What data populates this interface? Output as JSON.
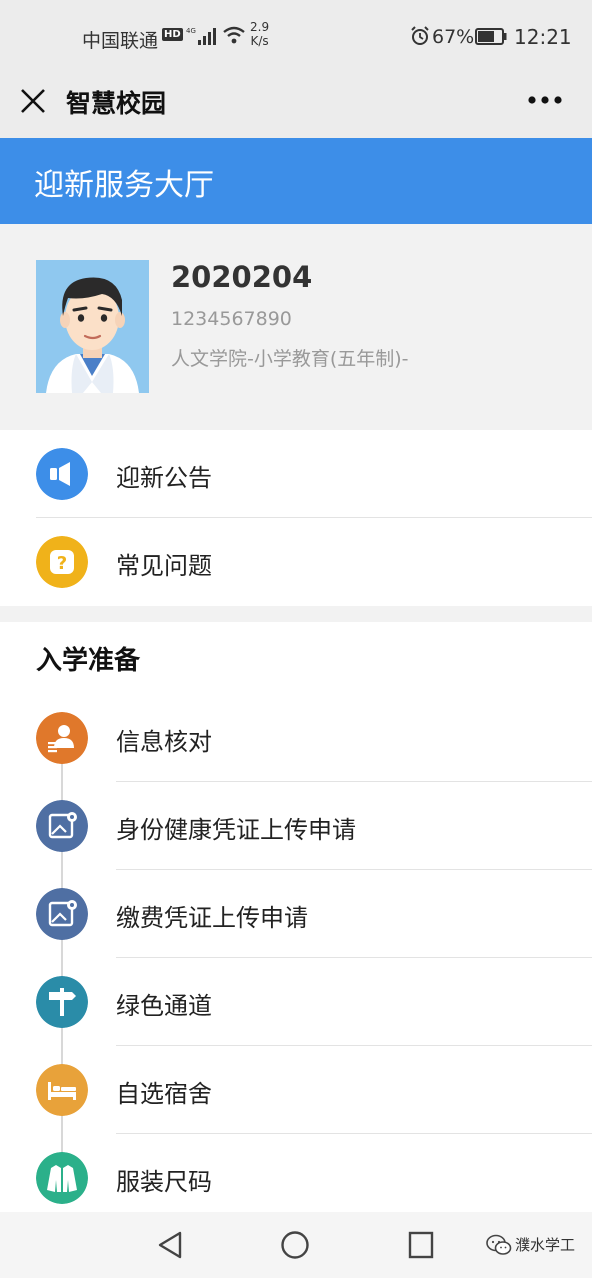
{
  "status_bar": {
    "carrier": "中国联通",
    "hd": "HD",
    "network": "4G",
    "speed_value": "2.9",
    "speed_unit": "K/s",
    "battery": "67%",
    "time": "12:21"
  },
  "top_bar": {
    "title": "智慧校园"
  },
  "header": {
    "title": "迎新服务大厅"
  },
  "profile": {
    "id": "2020204",
    "number": "1234567890",
    "major": "人文学院-小学教育(五年制)-"
  },
  "notice_items": [
    {
      "label": "迎新公告",
      "icon": "megaphone-icon",
      "color": "#3d8ee8"
    },
    {
      "label": "常见问题",
      "icon": "question-icon",
      "color": "#f0b21a"
    }
  ],
  "prep_section": {
    "title": "入学准备",
    "items": [
      {
        "label": "信息核对",
        "icon": "user-info-icon",
        "color": "#e0782b"
      },
      {
        "label": "身份健康凭证上传申请",
        "icon": "map-upload-icon",
        "color": "#4f6fa3"
      },
      {
        "label": "缴费凭证上传申请",
        "icon": "map-upload-icon",
        "color": "#4f6fa3"
      },
      {
        "label": "绿色通道",
        "icon": "signpost-icon",
        "color": "#2a8ca8"
      },
      {
        "label": "自选宿舍",
        "icon": "bed-icon",
        "color": "#e8a23a"
      },
      {
        "label": "服装尺码",
        "icon": "jacket-icon",
        "color": "#2bb08a"
      }
    ]
  },
  "watermark": {
    "text": "濮水学工"
  }
}
